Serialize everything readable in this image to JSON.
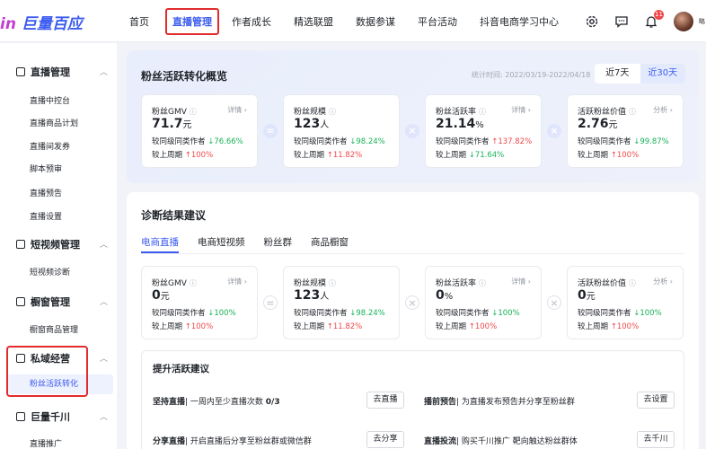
{
  "brand": {
    "logo": "巨量百应",
    "logo_prefix": "in"
  },
  "nav": [
    "首页",
    "直播管理",
    "作者成长",
    "精选联盟",
    "数据参谋",
    "平台活动",
    "抖音电商学习中心"
  ],
  "topbar": {
    "notification_count": "11",
    "user_initial": "略"
  },
  "sidebar": {
    "groups": [
      {
        "label": "直播管理",
        "items": [
          "直播中控台",
          "直播商品计划",
          "直播间发券",
          "脚本预审",
          "直播预告",
          "直播设置"
        ]
      },
      {
        "label": "短视频管理",
        "items": [
          "短视频诊断"
        ]
      },
      {
        "label": "橱窗管理",
        "items": [
          "橱窗商品管理"
        ]
      },
      {
        "label": "私域经营",
        "items": [
          "粉丝活跃转化"
        ]
      },
      {
        "label": "巨量千川",
        "items": [
          "直播推广"
        ]
      }
    ]
  },
  "overview": {
    "title": "粉丝活跃转化概览",
    "stat_time": "统计时间: 2022/03/19-2022/04/18",
    "ranges": [
      "近7天",
      "近30天"
    ],
    "metrics": [
      {
        "name": "粉丝GMV",
        "link": "详情",
        "value": "71.7",
        "unit": "元",
        "peer_label": "较同级同类作者",
        "peer": "76.66%",
        "peer_dir": "down",
        "period_label": "较上周期",
        "period": "100%",
        "period_dir": "up"
      },
      {
        "name": "粉丝规模",
        "link": "",
        "value": "123",
        "unit": "人",
        "peer_label": "较同级同类作者",
        "peer": "98.24%",
        "peer_dir": "down",
        "period_label": "较上周期",
        "period": "11.82%",
        "period_dir": "up"
      },
      {
        "name": "粉丝活跃率",
        "link": "详情",
        "value": "21.14",
        "unit": "%",
        "peer_label": "较同级同类作者",
        "peer": "137.82%",
        "peer_dir": "up",
        "period_label": "较上周期",
        "period": "71.64%",
        "period_dir": "down"
      },
      {
        "name": "活跃粉丝价值",
        "link": "分析",
        "value": "2.76",
        "unit": "元",
        "peer_label": "较同级同类作者",
        "peer": "99.87%",
        "peer_dir": "down",
        "period_label": "较上周期",
        "period": "100%",
        "period_dir": "up"
      }
    ]
  },
  "diagnosis": {
    "title": "诊断结果建议",
    "tabs": [
      "电商直播",
      "电商短视频",
      "粉丝群",
      "商品橱窗"
    ],
    "metrics": [
      {
        "name": "粉丝GMV",
        "link": "详情",
        "value": "0",
        "unit": "元",
        "peer_label": "较同级同类作者",
        "peer": "100%",
        "peer_dir": "down",
        "period_label": "较上周期",
        "period": "100%",
        "period_dir": "up"
      },
      {
        "name": "粉丝规模",
        "link": "",
        "value": "123",
        "unit": "人",
        "peer_label": "较同级同类作者",
        "peer": "98.24%",
        "peer_dir": "down",
        "period_label": "较上周期",
        "period": "11.82%",
        "period_dir": "up"
      },
      {
        "name": "粉丝活跃率",
        "link": "详情",
        "value": "0",
        "unit": "%",
        "peer_label": "较同级同类作者",
        "peer": "100%",
        "peer_dir": "down",
        "period_label": "较上周期",
        "period": "100%",
        "period_dir": "up"
      },
      {
        "name": "活跃粉丝价值",
        "link": "分析",
        "value": "0",
        "unit": "元",
        "peer_label": "较同级同类作者",
        "peer": "100%",
        "peer_dir": "down",
        "period_label": "较上周期",
        "period": "100%",
        "period_dir": "up"
      }
    ],
    "tips_title": "提升活跃建议",
    "tips": [
      {
        "title": "坚持直播",
        "desc": "| 一周内至少直播次数",
        "count": "0/3",
        "button": "去直播"
      },
      {
        "title": "播前预告",
        "desc": "| 为直播发布预告并分享至粉丝群",
        "count": "",
        "button": "去设置"
      },
      {
        "title": "分享直播",
        "desc": "| 开启直播后分享至粉丝群或微信群",
        "count": "",
        "button": "去分享"
      },
      {
        "title": "直播投流",
        "desc": "| 购买千川推广 靶向触达粉丝群体",
        "count": "",
        "button": "去千川"
      }
    ]
  },
  "colors": {
    "accent": "#3c5cf0",
    "down": "#19b35a",
    "up": "#f0484a",
    "highlight": "#e22c2c"
  }
}
